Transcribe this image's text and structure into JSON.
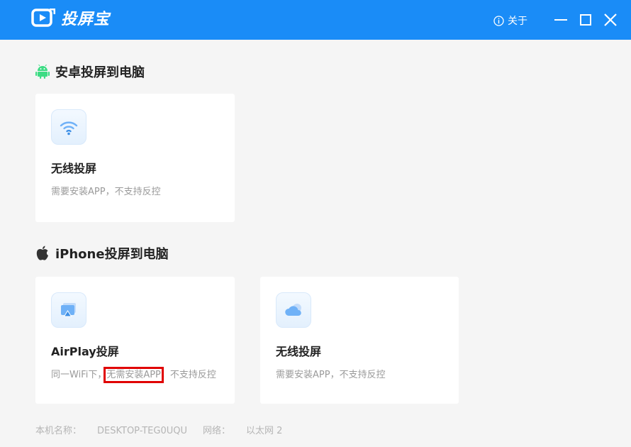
{
  "app": {
    "title": "投屏宝",
    "about_label": "关于"
  },
  "android": {
    "title": "安卓投屏到电脑",
    "cards": [
      {
        "title": "无线投屏",
        "desc": "需要安装APP，不支持反控"
      }
    ]
  },
  "iphone": {
    "title": "iPhone投屏到电脑",
    "cards": [
      {
        "title": "AirPlay投屏",
        "desc_pre": "同一WiFi下，",
        "desc_highlight": "无需安装APP",
        "desc_post": "，不支持反控"
      },
      {
        "title": "无线投屏",
        "desc": "需要安装APP，不支持反控"
      }
    ]
  },
  "footer": {
    "hostname_label": "本机名称：",
    "hostname_value": "DESKTOP-TEG0UQU",
    "network_label": "网络：",
    "network_value": "以太网 2"
  },
  "colors": {
    "titlebar": "#1a8cf7",
    "android_green": "#3ddc84",
    "highlight": "#e00000"
  }
}
